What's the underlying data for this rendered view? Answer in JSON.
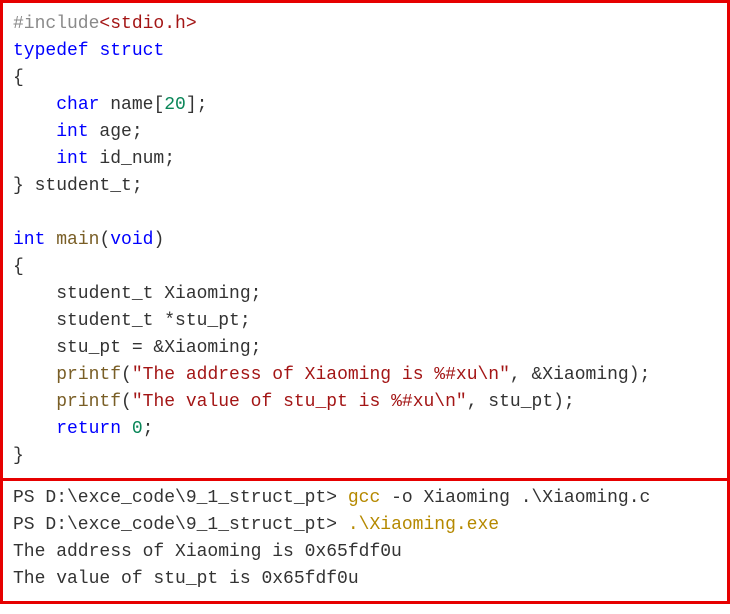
{
  "code": {
    "lines": [
      [
        {
          "cls": "preproc",
          "text": "#include"
        },
        {
          "cls": "include-path",
          "text": "<stdio.h>"
        }
      ],
      [
        {
          "cls": "keyword",
          "text": "typedef"
        },
        {
          "cls": "",
          "text": " "
        },
        {
          "cls": "keyword",
          "text": "struct"
        }
      ],
      [
        {
          "cls": "",
          "text": "{"
        }
      ],
      [
        {
          "cls": "",
          "text": "    "
        },
        {
          "cls": "keyword",
          "text": "char"
        },
        {
          "cls": "",
          "text": " name["
        },
        {
          "cls": "number",
          "text": "20"
        },
        {
          "cls": "",
          "text": "];"
        }
      ],
      [
        {
          "cls": "",
          "text": "    "
        },
        {
          "cls": "keyword",
          "text": "int"
        },
        {
          "cls": "",
          "text": " age;"
        }
      ],
      [
        {
          "cls": "",
          "text": "    "
        },
        {
          "cls": "keyword",
          "text": "int"
        },
        {
          "cls": "",
          "text": " id_num;"
        }
      ],
      [
        {
          "cls": "",
          "text": "} student_t;"
        }
      ],
      [
        {
          "cls": "",
          "text": ""
        }
      ],
      [
        {
          "cls": "keyword",
          "text": "int"
        },
        {
          "cls": "",
          "text": " "
        },
        {
          "cls": "func",
          "text": "main"
        },
        {
          "cls": "",
          "text": "("
        },
        {
          "cls": "keyword",
          "text": "void"
        },
        {
          "cls": "",
          "text": ")"
        }
      ],
      [
        {
          "cls": "",
          "text": "{"
        }
      ],
      [
        {
          "cls": "",
          "text": "    student_t Xiaoming;"
        }
      ],
      [
        {
          "cls": "",
          "text": "    student_t *stu_pt;"
        }
      ],
      [
        {
          "cls": "",
          "text": "    stu_pt = &Xiaoming;"
        }
      ],
      [
        {
          "cls": "",
          "text": "    "
        },
        {
          "cls": "func",
          "text": "printf"
        },
        {
          "cls": "",
          "text": "("
        },
        {
          "cls": "string",
          "text": "\"The address of Xiaoming is %#xu\\n\""
        },
        {
          "cls": "",
          "text": ", &Xiaoming);"
        }
      ],
      [
        {
          "cls": "",
          "text": "    "
        },
        {
          "cls": "func",
          "text": "printf"
        },
        {
          "cls": "",
          "text": "("
        },
        {
          "cls": "string",
          "text": "\"The value of stu_pt is %#xu\\n\""
        },
        {
          "cls": "",
          "text": ", stu_pt);"
        }
      ],
      [
        {
          "cls": "",
          "text": "    "
        },
        {
          "cls": "keyword",
          "text": "return"
        },
        {
          "cls": "",
          "text": " "
        },
        {
          "cls": "number",
          "text": "0"
        },
        {
          "cls": "",
          "text": ";"
        }
      ],
      [
        {
          "cls": "",
          "text": "}"
        }
      ]
    ]
  },
  "terminal": {
    "lines": [
      [
        {
          "cls": "",
          "text": "PS D:\\exce_code\\9_1_struct_pt> "
        },
        {
          "cls": "cmd-gcc",
          "text": "gcc"
        },
        {
          "cls": "",
          "text": " -o Xiaoming .\\Xiaoming.c"
        }
      ],
      [
        {
          "cls": "",
          "text": "PS D:\\exce_code\\9_1_struct_pt> "
        },
        {
          "cls": "cmd-exe",
          "text": ".\\Xiaoming.exe"
        }
      ],
      [
        {
          "cls": "",
          "text": "The address of Xiaoming is 0x65fdf0u"
        }
      ],
      [
        {
          "cls": "",
          "text": "The value of stu_pt is 0x65fdf0u"
        }
      ]
    ]
  }
}
